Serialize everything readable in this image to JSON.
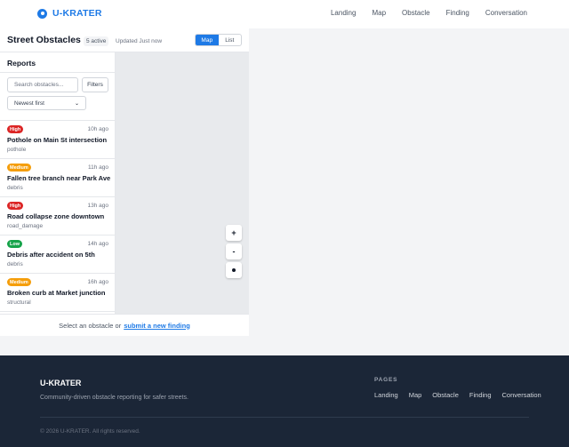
{
  "nav": {
    "brand": "U-KRATER",
    "links": [
      "Landing",
      "Map",
      "Obstacle",
      "Finding",
      "Conversation"
    ]
  },
  "header": {
    "title": "Street Obstacles",
    "active_count": "5 active",
    "updated": "Updated Just now",
    "view_toggle": {
      "map": "Map",
      "list": "List",
      "selected": "Map"
    }
  },
  "sidebar": {
    "heading": "Reports",
    "search_placeholder": "Search obstacles...",
    "filters_label": "Filters",
    "sort_selected": "Newest first",
    "items": [
      {
        "severity": "High",
        "time": "10h ago",
        "title": "Pothole on Main St intersection",
        "category": "pothole"
      },
      {
        "severity": "Medium",
        "time": "11h ago",
        "title": "Fallen tree branch near Park Ave",
        "category": "debris"
      },
      {
        "severity": "High",
        "time": "13h ago",
        "title": "Road collapse zone downtown",
        "category": "road_damage"
      },
      {
        "severity": "Low",
        "time": "14h ago",
        "title": "Debris after accident on 5th",
        "category": "debris"
      },
      {
        "severity": "Medium",
        "time": "16h ago",
        "title": "Broken curb at Market junction",
        "category": "structural"
      }
    ]
  },
  "map": {
    "zoom_in": "+",
    "zoom_out": "-"
  },
  "prompt": {
    "text": "Select an obstacle or",
    "link": "submit a new finding"
  },
  "footer": {
    "brand": "U-KRATER",
    "tagline": "Community-driven obstacle reporting for safer streets.",
    "pages_heading": "PAGES",
    "links": [
      "Landing",
      "Map",
      "Obstacle",
      "Finding",
      "Conversation"
    ],
    "copyright": "© 2026 U-KRATER. All rights reserved."
  },
  "colors": {
    "accent": "#1e7ae6",
    "high": "#dc2626",
    "medium": "#f59e0b",
    "low": "#16a34a",
    "footer_bg": "#1b2637"
  }
}
